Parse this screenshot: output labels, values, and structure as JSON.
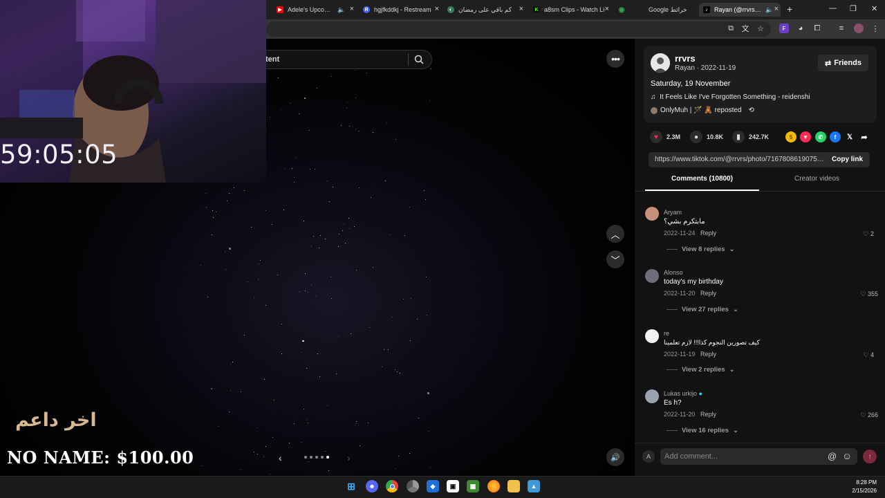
{
  "browser": {
    "tabs": [
      {
        "label": "Adele's Upcoming",
        "icon": "youtube-icon",
        "color": "#ff0000",
        "glyph": "▶",
        "audio": true
      },
      {
        "label": "hgjfkddkj - Restream",
        "icon": "restream-icon",
        "color": "#3f63f3",
        "glyph": "R",
        "audio": false
      },
      {
        "label": "كم باقي على رمضان",
        "icon": "web-favicon-icon",
        "color": "#3a7b5c",
        "glyph": "◐",
        "audio": false
      },
      {
        "label": "a8sm Clips - Watch Li",
        "icon": "kick-icon",
        "color": "#53fc18",
        "glyph": "K",
        "audio": false
      },
      {
        "label": "Google خرائط",
        "icon": "google-maps-icon",
        "color": "#34a853",
        "glyph": "◉",
        "audio": false
      },
      {
        "label": "Rayan (@rrvrs) | T",
        "icon": "tiktok-icon",
        "color": "#000000",
        "glyph": "♪",
        "audio": true
      }
    ],
    "new_tab": "+",
    "window_controls": {
      "minimize": "—",
      "restore": "❐",
      "close": "✕"
    }
  },
  "stream_overlay": {
    "timer": "59:05:05",
    "last_donor_label": "اخر داعم",
    "donation": "NO NAME: $100.00"
  },
  "search": {
    "placeholder_fragment": "tent"
  },
  "post": {
    "username": "rrvrs",
    "display_name": "Rayan",
    "date": "2022-11-19",
    "author_meta": "Rayan · 2022-11-19",
    "follow_button": "Friends",
    "caption": "Saturday, 19 November",
    "music": "It Feels Like I've Forgotten Something - reidenshi",
    "repost_text": "OnlyMuh | 🪄 🧸 reposted",
    "stats": {
      "likes": "2.3M",
      "comments": "10.8K",
      "saves": "242.7K"
    },
    "share_targets": [
      "coin",
      "tiktok-share",
      "whatsapp",
      "facebook",
      "x",
      "share"
    ],
    "link": "https://www.tiktok.com/@rrvrs/photo/71678086190758...",
    "copy_link": "Copy link",
    "carousel": {
      "slides": 5,
      "active": 5
    }
  },
  "tabs": {
    "comments": "Comments (10800)",
    "creator": "Creator videos"
  },
  "comments": [
    {
      "name": "Aryam",
      "text": "مابتكرم بشي؟",
      "date": "2022-11-24",
      "reply": "Reply",
      "likes": "2",
      "view_replies": "View 8 replies",
      "avatar_color": "#c6907a",
      "verified": false
    },
    {
      "name": "Alonso",
      "text": "today's my birthday",
      "date": "2022-11-20",
      "reply": "Reply",
      "likes": "355",
      "view_replies": "View 27 replies",
      "avatar_color": "#6d6d7d",
      "verified": false
    },
    {
      "name": "re",
      "text": "كيف تصورين النجوم كذا!!! لازم تعلمينا",
      "date": "2022-11-19",
      "reply": "Reply",
      "likes": "4",
      "view_replies": "View 2 replies",
      "avatar_color": "#f2f2f2",
      "verified": false
    },
    {
      "name": "Lukas urkijo",
      "text": "Es h?",
      "date": "2022-11-20",
      "reply": "Reply",
      "likes": "266",
      "view_replies": "View 16 replies",
      "avatar_color": "#9aa3ad",
      "verified": true
    }
  ],
  "comment_input": {
    "placeholder": "Add comment..."
  },
  "taskbar": {
    "apps": [
      "windows-start-icon",
      "discord-icon",
      "chrome-icon",
      "chrome-alt-icon",
      "vpn-icon",
      "capcut-icon",
      "minecraft-icon",
      "firefox-icon",
      "file-explorer-icon",
      "photos-icon"
    ],
    "time": "8:28 PM",
    "date": "2/15/2026"
  },
  "colors": {
    "like": "#fe2c55",
    "verified": "#20d5ec",
    "accent": "#fe2c55"
  }
}
